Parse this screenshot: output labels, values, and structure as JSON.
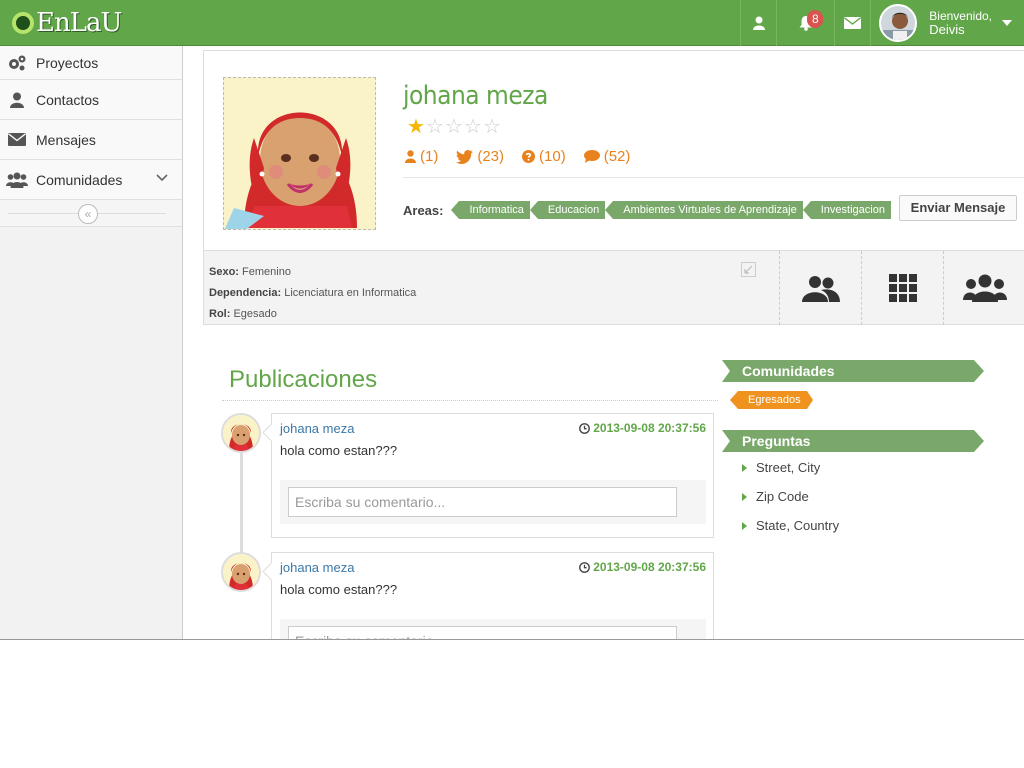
{
  "app": {
    "logo_text": "EnLaU"
  },
  "topbar": {
    "notification_count": "8",
    "greeting": "Bienvenido,",
    "user_name": "Deivis",
    "icons": [
      "user-icon",
      "bell-icon",
      "envelope-icon",
      "chevron-down-icon"
    ]
  },
  "sidebar": {
    "items": [
      {
        "label": "Proyectos",
        "icon": "gears-icon"
      },
      {
        "label": "Contactos",
        "icon": "user-icon"
      },
      {
        "label": "Mensajes",
        "icon": "envelope-icon"
      },
      {
        "label": "Comunidades",
        "icon": "users-icon",
        "has_submenu": true
      }
    ],
    "collapse_glyph": "«"
  },
  "profile": {
    "name": "johana meza",
    "rating": 1,
    "rating_max": 5,
    "stats": {
      "followers": "(1)",
      "twitter": "(23)",
      "questions": "(10)",
      "comments": "(52)"
    },
    "areas_label": "Areas:",
    "areas": [
      "Informatica",
      "Educacion",
      "Ambientes Virtuales de Aprendizaje",
      "Investigacion"
    ],
    "send_message_label": "Enviar Mensaje",
    "info": {
      "sexo_label": "Sexo:",
      "sexo": "Femenino",
      "dependencia_label": "Dependencia:",
      "dependencia": "Licenciatura en Informatica",
      "rol_label": "Rol:",
      "rol": "Egesado"
    }
  },
  "publications": {
    "title": "Publicaciones",
    "posts": [
      {
        "author": "johana meza",
        "date": "2013-09-08 20:37:56",
        "message": "hola como estan???",
        "comment_placeholder": "Escriba su comentario..."
      },
      {
        "author": "johana meza",
        "date": "2013-09-08 20:37:56",
        "message": "hola como estan???",
        "comment_placeholder": "Escriba su comentario..."
      }
    ]
  },
  "widgets": {
    "communities_title": "Comunidades",
    "communities": [
      "Egresados"
    ],
    "questions_title": "Preguntas",
    "questions": [
      "Street, City",
      "Zip Code",
      "State, Country"
    ]
  },
  "colors": {
    "brand_green": "#62a64a",
    "tag_green": "#7aa86a",
    "accent_orange": "#e8821e",
    "badge_red": "#d9534f"
  }
}
